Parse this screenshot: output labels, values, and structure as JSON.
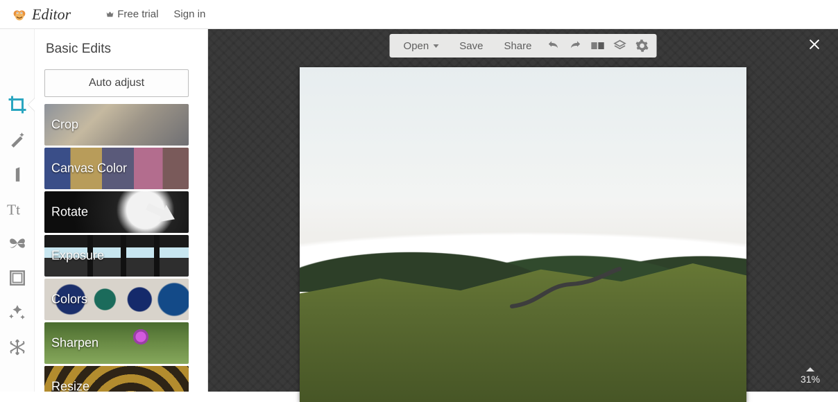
{
  "header": {
    "brand": "Editor",
    "free_trial": "Free trial",
    "sign_in": "Sign in"
  },
  "panel": {
    "title": "Basic Edits",
    "auto_adjust": "Auto adjust",
    "items": [
      "Crop",
      "Canvas Color",
      "Rotate",
      "Exposure",
      "Colors",
      "Sharpen",
      "Resize"
    ]
  },
  "toolbar": {
    "open": "Open",
    "save": "Save",
    "share": "Share"
  },
  "zoom": "31%"
}
